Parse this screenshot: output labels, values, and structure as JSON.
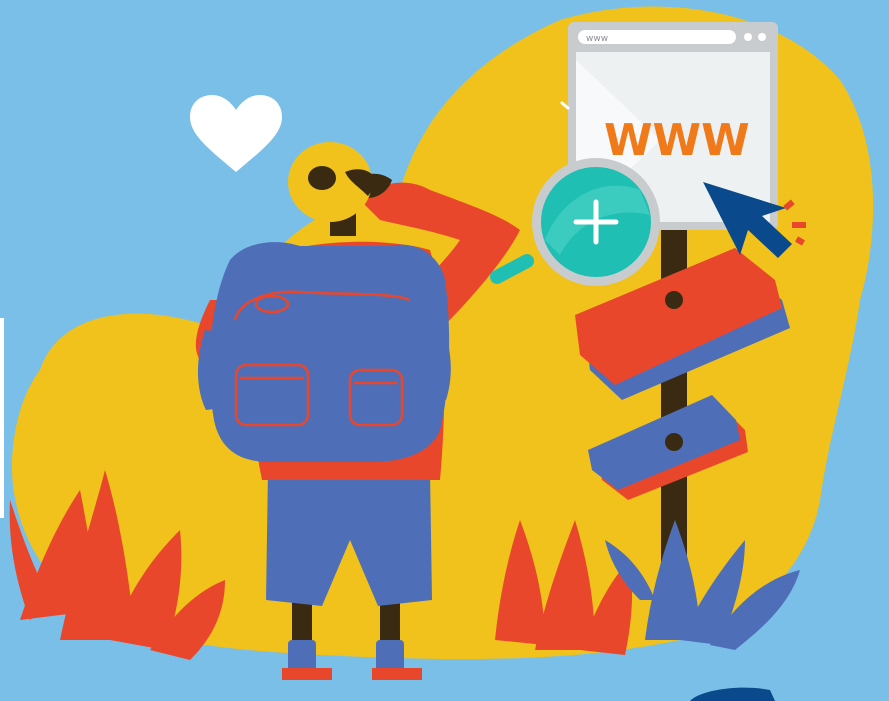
{
  "colors": {
    "background": "#7abfe8",
    "blob": "#f0c21b",
    "orange_red": "#e9472c",
    "blue": "#4e6fb8",
    "teal": "#1fc0b3",
    "dark_blue": "#0a4a8c",
    "skin": "#3a2a12",
    "white": "#ffffff"
  },
  "browser": {
    "url_text": "www",
    "page_text": "WWW"
  },
  "icons": [
    "heart-icon",
    "magnifier-icon",
    "cursor-arrow-icon",
    "plus-icon"
  ]
}
